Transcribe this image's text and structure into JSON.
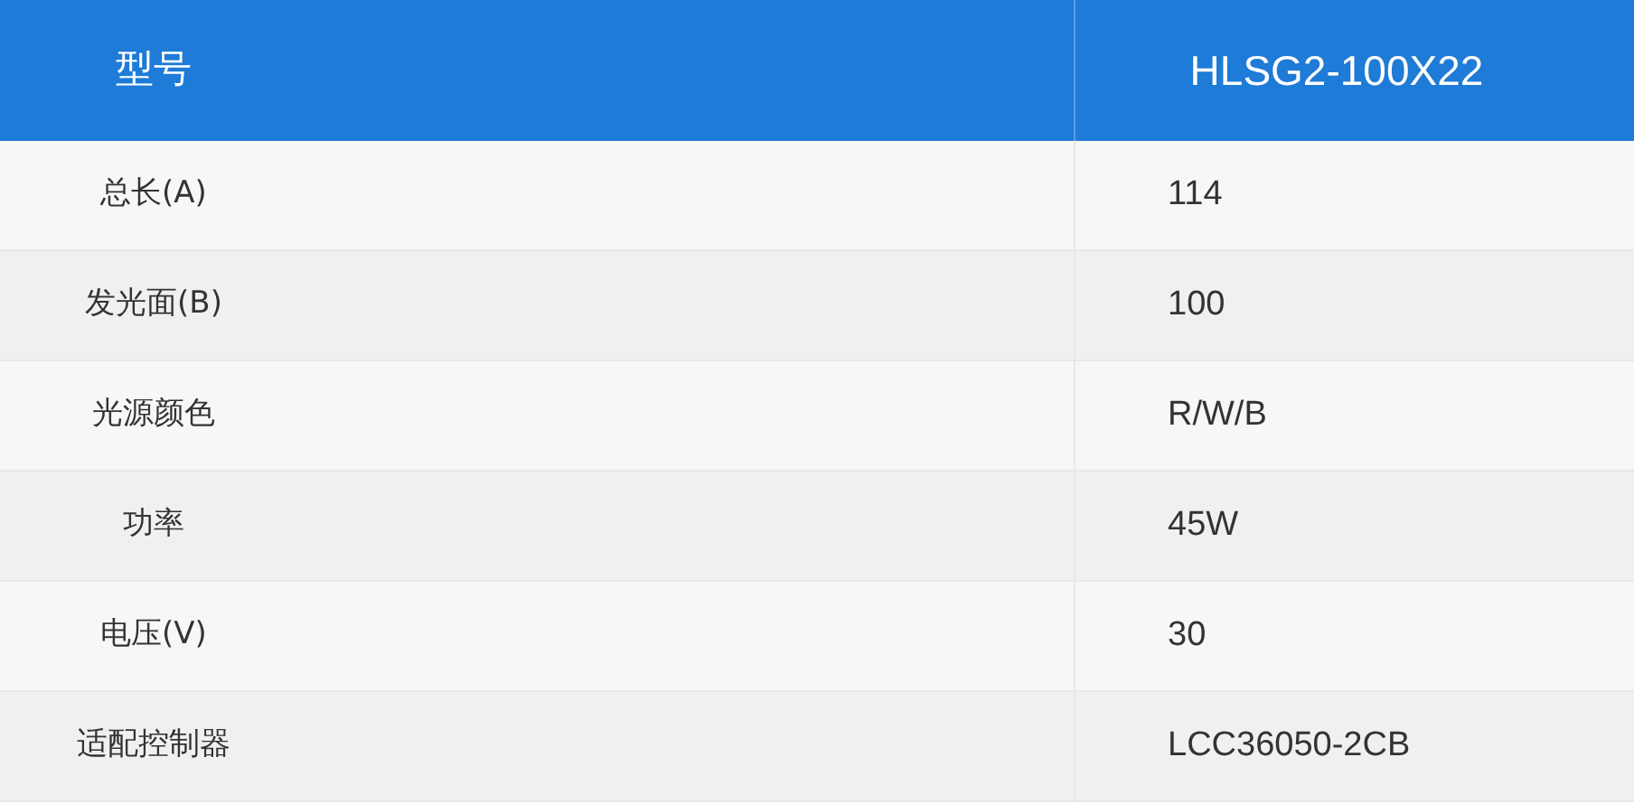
{
  "table": {
    "header": {
      "label": "型号",
      "value": "HLSG2-100X22"
    },
    "rows": [
      {
        "label": "总长(A)",
        "value": "114"
      },
      {
        "label": "发光面(B)",
        "value": "100"
      },
      {
        "label": "光源颜色",
        "value": "R/W/B"
      },
      {
        "label": "功率",
        "value": "45W"
      },
      {
        "label": "电压(V)",
        "value": "30"
      },
      {
        "label": "适配控制器",
        "value": "LCC36050-2CB"
      }
    ]
  }
}
